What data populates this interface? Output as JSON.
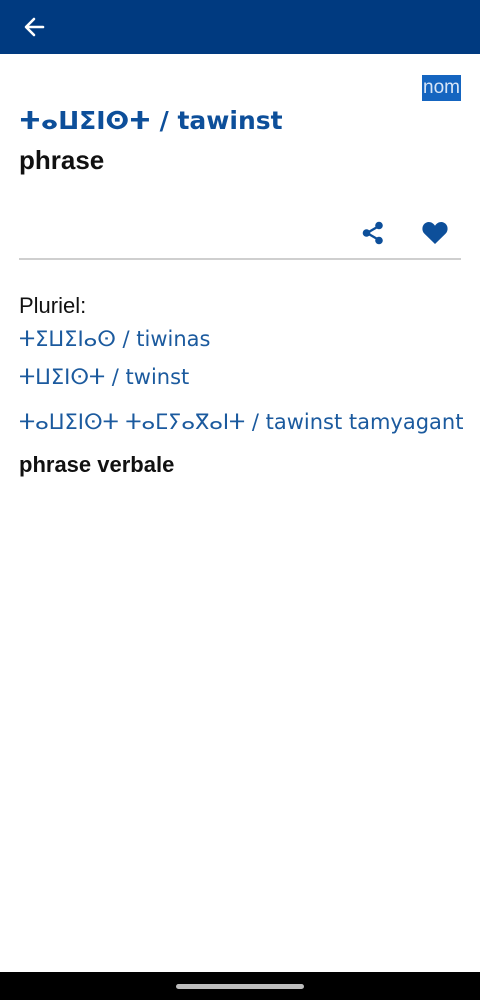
{
  "header": {
    "back_icon": "arrow-left-icon",
    "background_color": "#003a80"
  },
  "entry": {
    "part_of_speech": "nom",
    "headword": "ⵜⴰⵡⵉⵏⵙⵜ / tawinst",
    "definition": "phrase",
    "accent_color": "#0d4f9a"
  },
  "actions": {
    "share_icon": "share-icon",
    "favorite_icon": "heart-icon"
  },
  "plural": {
    "label": "Pluriel:",
    "forms": [
      "ⵜⵉⵡⵉⵏⴰⵙ / tiwinas",
      "ⵜⵡⵉⵏⵙⵜ / twinst"
    ]
  },
  "related": [
    {
      "term": "ⵜⴰⵡⵉⵏⵙⵜ ⵜⴰⵎⵢⴰⴳⴰⵏⵜ / tawinst tamyagant",
      "definition": "phrase verbale"
    }
  ]
}
